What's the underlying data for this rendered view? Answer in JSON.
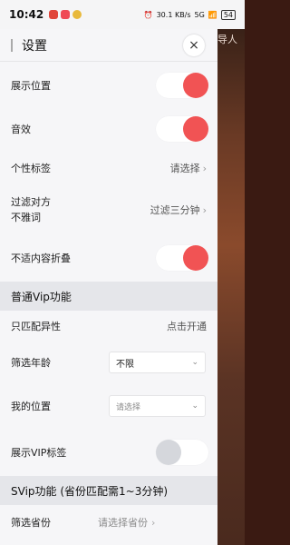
{
  "status": {
    "time": "10:42",
    "network": "30.1 KB/s",
    "signal": "5G",
    "battery": "54",
    "app_colors": [
      "#e0463a",
      "#ef4a55",
      "#e8b93c"
    ]
  },
  "background": {
    "peek_text": "导人"
  },
  "header": {
    "title": "设置",
    "close_icon": "×"
  },
  "rows": {
    "show_location": {
      "label": "展示位置",
      "on": true
    },
    "sound": {
      "label": "音效",
      "on": true
    },
    "personal_tag": {
      "label": "个性标签",
      "value": "请选择"
    },
    "filter": {
      "label_line1": "过滤对方",
      "label_line2": "不雅词",
      "value": "过滤三分钟"
    },
    "fold": {
      "label": "不适内容折叠",
      "on": true
    }
  },
  "vip": {
    "section_title": "普通Vip功能",
    "opposite_sex": {
      "label": "只匹配异性",
      "value": "点击开通"
    },
    "age": {
      "label": "筛选年龄",
      "selected": "不限"
    },
    "location": {
      "label": "我的位置",
      "placeholder": "请选择"
    },
    "show_tag": {
      "label": "展示VIP标签",
      "on": false
    }
  },
  "svip": {
    "section_title": "SVip功能 (省份匹配需1~3分钟)",
    "province": {
      "label": "筛选省份",
      "value": "请选择省份"
    }
  },
  "colors": {
    "accent": "#f15354",
    "toggle_off": "#d5d7dc"
  },
  "chevron": "›",
  "dropdown_chevron": "⌄"
}
